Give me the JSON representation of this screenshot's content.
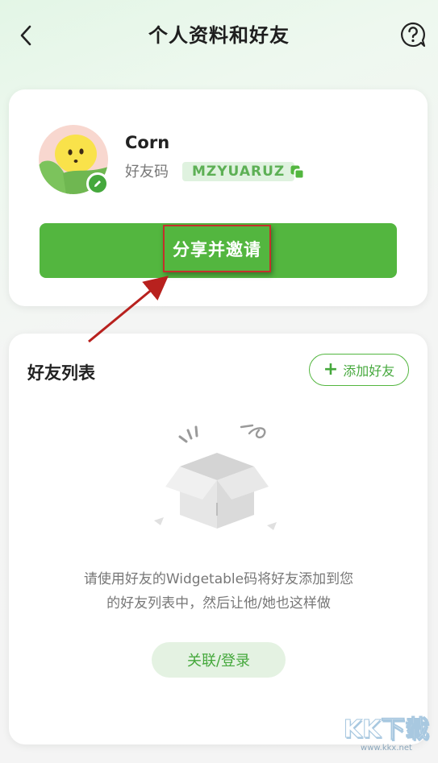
{
  "header": {
    "title": "个人资料和好友"
  },
  "profile": {
    "name": "Corn",
    "friend_code_label": "好友码",
    "friend_code": "MZYUARUZ",
    "share_button_label": "分享并邀请"
  },
  "friends": {
    "title": "好友列表",
    "add_button_label": "添加好友",
    "empty_line_1": "请使用好友的Widgetable码将好友添加到您",
    "empty_line_2": "的好友列表中，然后让他/她也这样做",
    "login_button_label": "关联/登录"
  },
  "watermark": {
    "text": "KK下载",
    "url": "www.kkx.net"
  },
  "colors": {
    "accent": "#53b63f",
    "highlight_border": "#c4302b"
  }
}
